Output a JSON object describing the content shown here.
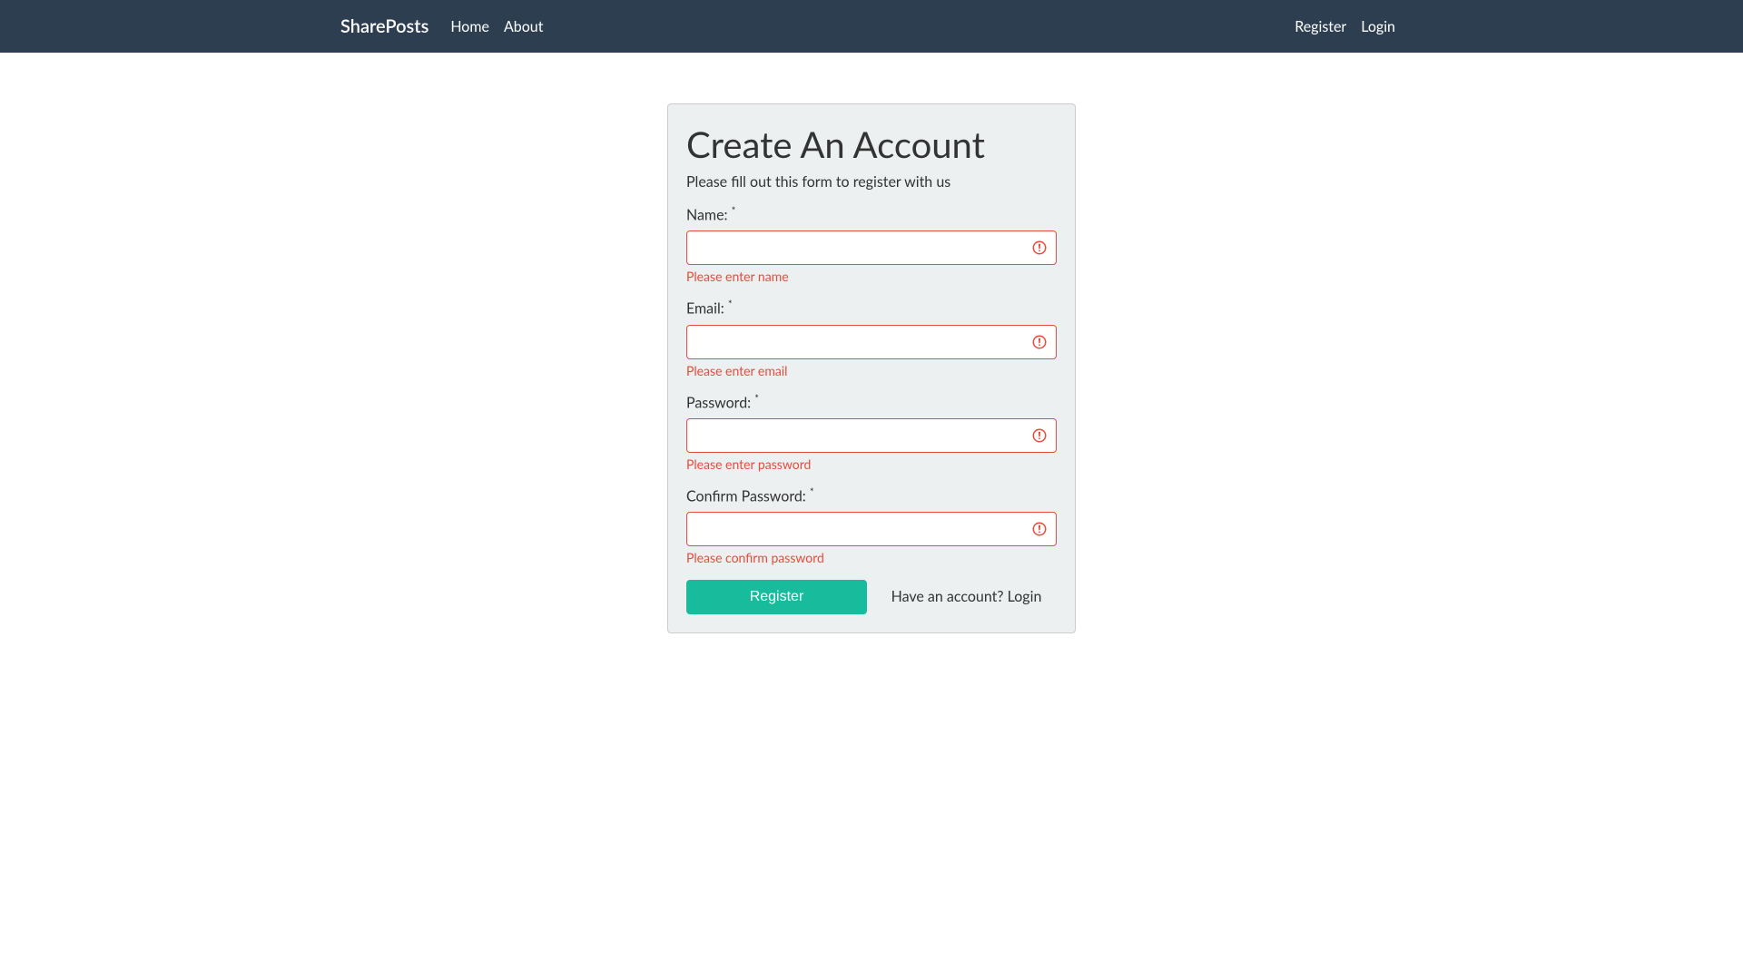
{
  "navbar": {
    "brand": "SharePosts",
    "left_links": [
      {
        "label": "Home"
      },
      {
        "label": "About"
      }
    ],
    "right_links": [
      {
        "label": "Register"
      },
      {
        "label": "Login"
      }
    ]
  },
  "card": {
    "title": "Create An Account",
    "subtitle": "Please fill out this form to register with us"
  },
  "form": {
    "fields": {
      "name": {
        "label": "Name: ",
        "error": "Please enter name",
        "value": ""
      },
      "email": {
        "label": "Email: ",
        "error": "Please enter email",
        "value": ""
      },
      "password": {
        "label": "Password: ",
        "error": "Please enter password",
        "value": ""
      },
      "confirm_password": {
        "label": "Confirm Password: ",
        "error": "Please confirm password",
        "value": ""
      }
    },
    "required_mark": "*",
    "submit_label": "Register",
    "login_link_label": "Have an account? Login"
  }
}
